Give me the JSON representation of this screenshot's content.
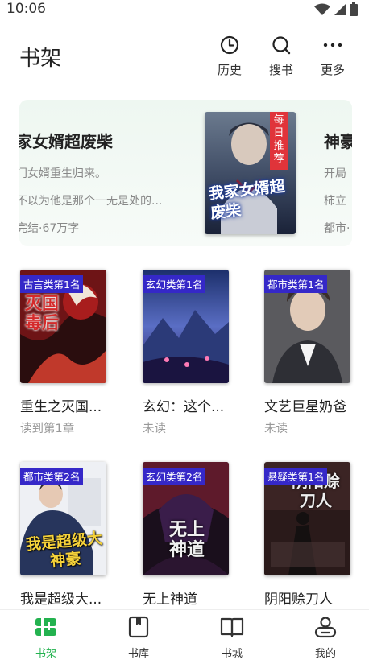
{
  "status_bar": {
    "time": "10:06"
  },
  "header": {
    "title": "书架",
    "actions": [
      {
        "label": "历史",
        "icon": "clock-icon"
      },
      {
        "label": "搜书",
        "icon": "search-icon"
      },
      {
        "label": "更多",
        "icon": "more-dots-icon"
      }
    ]
  },
  "banner": {
    "left": {
      "title": "家女婿超废柴",
      "line1": "门女婿重生归来。",
      "line2": "不以为他是那个一无是处的...",
      "meta": "完结·67万字"
    },
    "cover": {
      "badge": "每日推荐",
      "title": "我家女婿超废柴"
    },
    "right": {
      "title": "神豪",
      "line1": "开局",
      "line2": "柿立",
      "meta": "都市·"
    }
  },
  "books": [
    {
      "rank": "古言类第1名",
      "title": "重生之灭国...",
      "status": "读到第1章",
      "cover_text": "灭国毒后"
    },
    {
      "rank": "玄幻类第1名",
      "title": "玄幻：这个...",
      "status": "未读",
      "cover_text": ""
    },
    {
      "rank": "都市类第1名",
      "title": "文艺巨星奶爸",
      "status": "未读",
      "cover_text": ""
    },
    {
      "rank": "都市类第2名",
      "title": "我是超级大...",
      "status": "",
      "cover_text": "我是超级大神豪"
    },
    {
      "rank": "玄幻类第2名",
      "title": "无上神道",
      "status": "",
      "cover_text": "无上神道"
    },
    {
      "rank": "悬疑类第1名",
      "title": "阴阳赊刀人",
      "status": "",
      "cover_text": "阴阳赊刀人"
    }
  ],
  "bottom_nav": [
    {
      "label": "书架",
      "icon": "bookshelf-icon",
      "active": true
    },
    {
      "label": "书库",
      "icon": "library-icon",
      "active": false
    },
    {
      "label": "书城",
      "icon": "open-book-icon",
      "active": false
    },
    {
      "label": "我的",
      "icon": "profile-icon",
      "active": false
    }
  ],
  "colors": {
    "accent": "#23b24f",
    "badge": "#3528c8",
    "recommend_badge": "#e0343a"
  }
}
